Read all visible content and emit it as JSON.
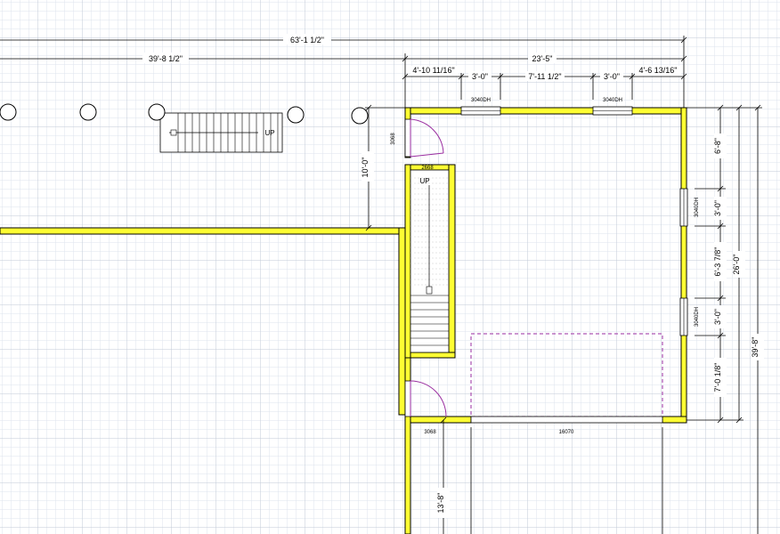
{
  "colors": {
    "grid_minor": "#dde3ec",
    "grid_major": "#c2cad7",
    "wall_fill": "#ffff33",
    "wall_stroke": "#000000",
    "dimension": "#000000",
    "door": "#9a2ea0",
    "garage_door_outline": "#9a2ea0"
  },
  "dimensions": {
    "overall_top": "63'-1 1/2\"",
    "left_span": "39'-8 1/2\"",
    "garage_width": "23'-5\"",
    "seg_a": "4'-10 11/16\"",
    "seg_b": "3'-0\"",
    "seg_c": "7'-11 1/2\"",
    "seg_d": "3'-0\"",
    "seg_e": "4'-6 13/16\"",
    "porch_depth": "10'-0\"",
    "right_seg_1": "6'-8\"",
    "right_seg_2": "3'-0\"",
    "right_seg_3": "6'-3 7/8\"",
    "right_seg_4": "3'-0\"",
    "right_seg_5": "7'-0 1/8\"",
    "garage_depth": "26'-0\"",
    "overall_right": "39'-8\"",
    "bottom_left": "13'-8\""
  },
  "labels": {
    "window_top_1": "3040DH",
    "window_top_2": "3040DH",
    "window_right_1": "3040DH",
    "window_right_2": "3040DH",
    "door_top": "3068",
    "door_stair": "2668",
    "door_bottom": "3068",
    "garage_door": "16070",
    "stair_up_interior": "UP",
    "stair_up_exterior": "UP"
  },
  "icons": {
    "porch_post": "circle-post-icon",
    "door_swing": "door-swing-icon",
    "stair_arrow": "stair-direction-arrow-icon"
  }
}
